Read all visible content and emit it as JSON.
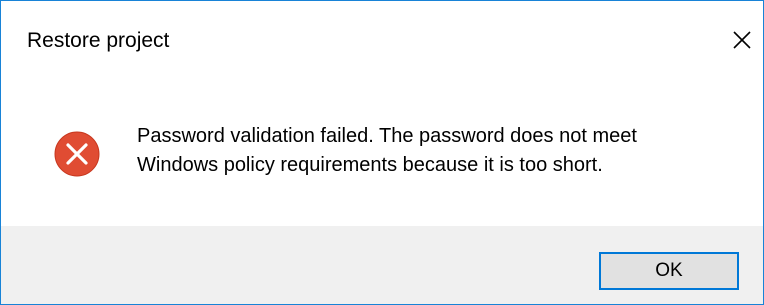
{
  "window": {
    "title": "Restore project",
    "close_icon": "close-icon",
    "border_color": "#1883d7"
  },
  "content": {
    "icon": "error-icon",
    "icon_color": "#e81123",
    "message": "Password validation failed. The password does not meet\nWindows policy requirements because it is too short."
  },
  "footer": {
    "ok_label": "OK",
    "background": "#f0f0f0"
  }
}
